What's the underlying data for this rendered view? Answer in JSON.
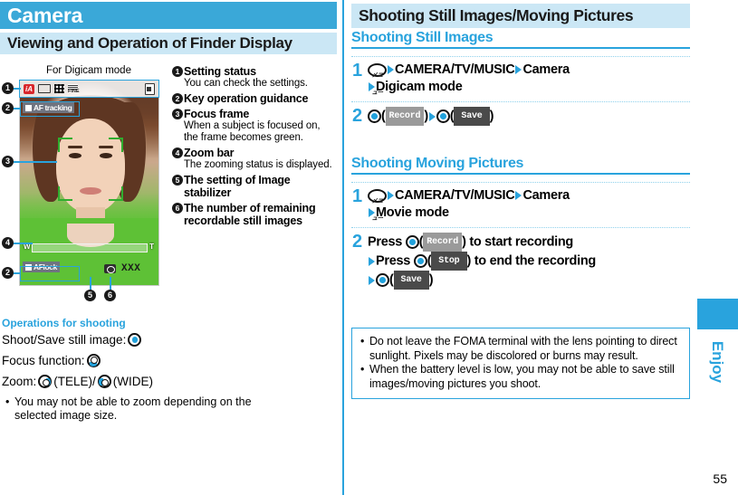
{
  "left": {
    "chapter_title": "Camera",
    "section_title": "Viewing and Operation of Finder Display",
    "figure_caption": "For Digicam mode",
    "finder": {
      "status_icons": [
        "iA",
        "frame-icon",
        "size-icon",
        "FINE",
        "card-icon"
      ],
      "af_tracking_label": "AF tracking",
      "af_lock_label": "AFlock",
      "zoom_wide_mark": "W",
      "zoom_tele_mark": "T",
      "remaining_count": "XXX"
    },
    "callouts": [
      "1",
      "2",
      "3",
      "4",
      "2",
      "5",
      "6"
    ],
    "explanations": [
      {
        "num": "1",
        "title": "Setting status",
        "body": "You can check the settings."
      },
      {
        "num": "2",
        "title": "Key operation guidance",
        "body": ""
      },
      {
        "num": "3",
        "title": "Focus frame",
        "body": "When a subject is focused on, the frame becomes green."
      },
      {
        "num": "4",
        "title": "Zoom bar",
        "body": "The zooming status is displayed."
      },
      {
        "num": "5",
        "title": "The setting of Image stabilizer",
        "body": ""
      },
      {
        "num": "6",
        "title": "The number of remaining recordable still images",
        "body": ""
      }
    ],
    "operations": {
      "heading": "Operations for shooting",
      "shoot_label": "Shoot/Save still image:",
      "focus_label": "Focus function:",
      "zoom_label": "Zoom:",
      "tele_text": "(TELE)/",
      "wide_text": "(WIDE)",
      "note": "You may not be able to zoom depending on the selected image size."
    }
  },
  "right": {
    "title": "Shooting Still Images/Moving Pictures",
    "still": {
      "heading": "Shooting Still Images",
      "steps": [
        {
          "num": "1",
          "part1": "CAMERA/TV/MUSIC",
          "part2": "Camera",
          "part3": "Digicam mode"
        },
        {
          "num": "2",
          "chip1": "Record",
          "chip2": "Save"
        }
      ]
    },
    "moving": {
      "heading": "Shooting Moving Pictures",
      "steps": [
        {
          "num": "1",
          "part1": "CAMERA/TV/MUSIC",
          "part2": "Camera",
          "part3": "Movie mode"
        },
        {
          "num": "2",
          "pre": "Press",
          "chip1": "Record",
          "mid1": ") to start recording",
          "pre2": "Press",
          "chip2": "Stop",
          "mid2": ") to end the recording",
          "chip3": "Save"
        }
      ]
    },
    "notes": [
      "Do not leave the FOMA terminal with the lens pointing to direct sunlight. Pixels may be discolored or burns may result.",
      "When the battery level is low, you may not be able to save still images/moving pictures you shoot."
    ]
  },
  "tab": {
    "label": "Enjoy"
  },
  "page_number": "55",
  "colors": {
    "accent": "#29a3dd",
    "header": "#3aa8d8",
    "light": "#cbe7f5"
  }
}
